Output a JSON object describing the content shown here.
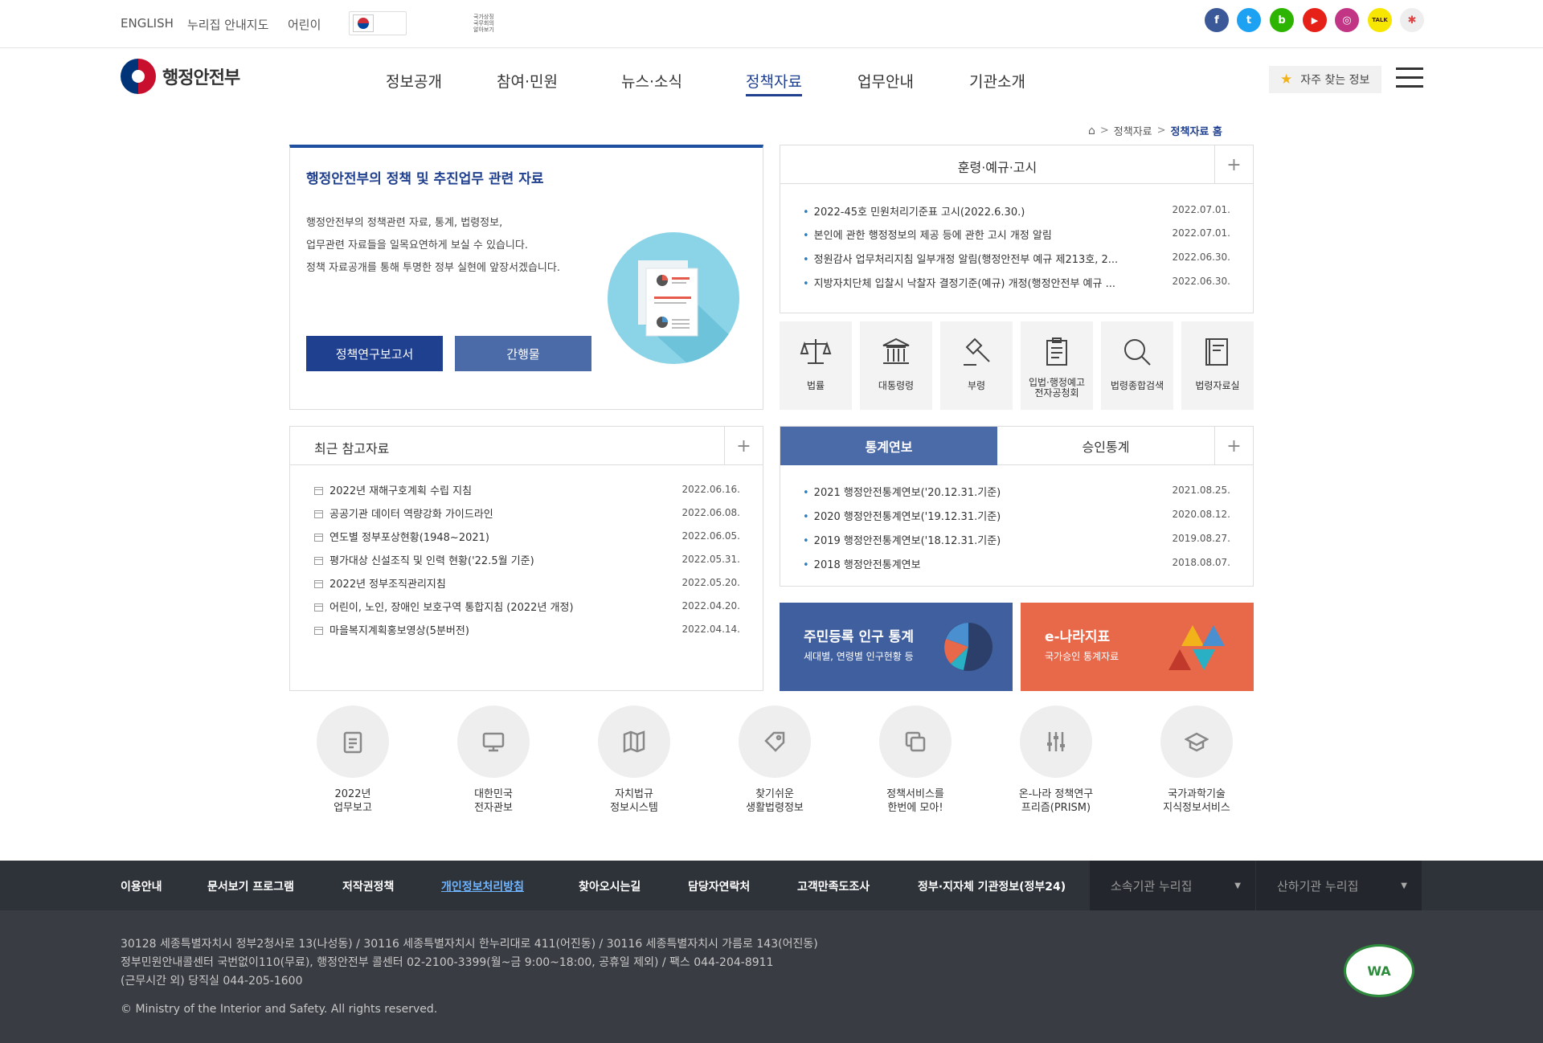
{
  "topbar": {
    "links": [
      "ENGLISH",
      "누리집 안내지도",
      "어린이"
    ],
    "flag_text": "국가상징 국무회의 알아보기",
    "social": [
      {
        "name": "facebook",
        "glyph": "f",
        "color": "#3b5998"
      },
      {
        "name": "twitter",
        "glyph": "t",
        "color": "#1da1f2"
      },
      {
        "name": "blog",
        "glyph": "b",
        "color": "#2db400"
      },
      {
        "name": "youtube",
        "glyph": "▶",
        "color": "#e62117"
      },
      {
        "name": "instagram",
        "glyph": "◎",
        "color": "#c13584"
      },
      {
        "name": "kakaotalk",
        "glyph": "TALK",
        "color": "#f7e600"
      },
      {
        "name": "extra",
        "glyph": "✱",
        "color": "#eeeeee"
      }
    ]
  },
  "header": {
    "logo_text": "행정안전부",
    "nav": [
      "정보공개",
      "참여·민원",
      "뉴스·소식",
      "정책자료",
      "업무안내",
      "기관소개"
    ],
    "active_nav": "정책자료",
    "favorites_label": "자주 찾는 정보"
  },
  "breadcrumb": {
    "items": [
      "정책자료",
      "정책자료 홈"
    ]
  },
  "intro": {
    "title": "행정안전부의 정책 및 추진업무 관련 자료",
    "desc": [
      "행정안전부의 정책관련 자료, 통계, 법령정보,",
      "업무관련 자료들을 일목요연하게 보실 수 있습니다.",
      "정책 자료공개를 통해 투명한 정부 실현에 앞장서겠습니다."
    ],
    "btn_research": "정책연구보고서",
    "btn_pub": "간행물"
  },
  "notices": {
    "title": "훈령·예규·고시",
    "items": [
      {
        "title": "2022-45호 민원처리기준표 고시(2022.6.30.)",
        "date": "2022.07.01."
      },
      {
        "title": "본인에 관한 행정정보의 제공 등에 관한 고시 개정 알림",
        "date": "2022.07.01."
      },
      {
        "title": "정원감사 업무처리지침 일부개정 알림(행정안전부 예규 제213호, 2...",
        "date": "2022.06.30."
      },
      {
        "title": "지방자치단체 입찰시 낙찰자 결정기준(예규) 개정(행정안전부 예규 ...",
        "date": "2022.06.30."
      }
    ]
  },
  "law_tiles": [
    {
      "label": "법률",
      "icon": "scale-icon"
    },
    {
      "label": "대통령령",
      "icon": "building-icon"
    },
    {
      "label": "부령",
      "icon": "gavel-icon"
    },
    {
      "label": "입법·행정예고 전자공청회",
      "icon": "clipboard-icon"
    },
    {
      "label": "법령종합검색",
      "icon": "search-icon"
    },
    {
      "label": "법령자료실",
      "icon": "book-icon"
    }
  ],
  "recent": {
    "title": "최근 참고자료",
    "items": [
      {
        "title": "2022년 재해구호계획 수립 지침",
        "date": "2022.06.16."
      },
      {
        "title": "공공기관 데이터 역량강화 가이드라인",
        "date": "2022.06.08."
      },
      {
        "title": "연도별 정부포상현황(1948~2021)",
        "date": "2022.06.05."
      },
      {
        "title": "평가대상 신설조직 및 인력 현황('22.5월 기준)",
        "date": "2022.05.31."
      },
      {
        "title": "2022년 정부조직관리지침",
        "date": "2022.05.20."
      },
      {
        "title": "어린이, 노인, 장애인 보호구역 통합지침 (2022년 개정)",
        "date": "2022.04.20."
      },
      {
        "title": "마을복지계획홍보영상(5분버전)",
        "date": "2022.04.14."
      }
    ]
  },
  "stats": {
    "tabs": [
      "통계연보",
      "승인통계"
    ],
    "active_tab": "통계연보",
    "items": [
      {
        "title": "2021 행정안전통계연보('20.12.31.기준)",
        "date": "2021.08.25."
      },
      {
        "title": "2020 행정안전통계연보('19.12.31.기준)",
        "date": "2020.08.12."
      },
      {
        "title": "2019 행정안전통계연보('18.12.31.기준)",
        "date": "2019.08.27."
      },
      {
        "title": "2018 행정안전통계연보",
        "date": "2018.08.07."
      }
    ]
  },
  "banners": [
    {
      "title": "주민등록 인구 통계",
      "sub": "세대별, 연령별 인구현황 등",
      "color": "#3f5f9f"
    },
    {
      "title": "e-나라지표",
      "sub": "국가승인 통계자료",
      "color": "#e8694a"
    }
  ],
  "quick": [
    {
      "label1": "2022년",
      "label2": "업무보고",
      "icon": "clipboard-icon"
    },
    {
      "label1": "대한민국",
      "label2": "전자관보",
      "icon": "monitor-icon"
    },
    {
      "label1": "자치법규",
      "label2": "정보시스템",
      "icon": "map-book-icon"
    },
    {
      "label1": "찾기쉬운",
      "label2": "생활법령정보",
      "icon": "tag-icon"
    },
    {
      "label1": "정책서비스를",
      "label2": "한번에 모아!",
      "icon": "copy-icon"
    },
    {
      "label1": "온-나라 정책연구",
      "label2": "프리즘(PRISM)",
      "icon": "sliders-icon"
    },
    {
      "label1": "국가과학기술",
      "label2": "지식정보서비스",
      "icon": "graduation-icon"
    }
  ],
  "footer": {
    "nav": [
      "이용안내",
      "문서보기 프로그램",
      "저작권정책",
      "개인정보처리방침",
      "찾아오시는길",
      "담당자연락처",
      "고객만족도조사",
      "정부·지자체 기관정보(정부24)"
    ],
    "highlight": "개인정보처리방침",
    "selects": [
      "소속기관 누리집",
      "산하기관 누리집"
    ],
    "address1": "30128 세종특별자치시 정부2청사로 13(나성동) / 30116 세종특별자치시 한누리대로 411(어진동) / 30116 세종특별자치시 가름로 143(어진동)",
    "address2": "정부민원안내콜센터 국번없이110(무료), 행정안전부 콜센터 02-2100-3399(월~금 9:00~18:00, 공휴일 제외) / 팩스 044-204-8911",
    "address3": "(근무시간 외) 당직실 044-205-1600",
    "copyright": "© Ministry of the Interior and Safety. All rights reserved.",
    "wa_mark": "WA"
  }
}
